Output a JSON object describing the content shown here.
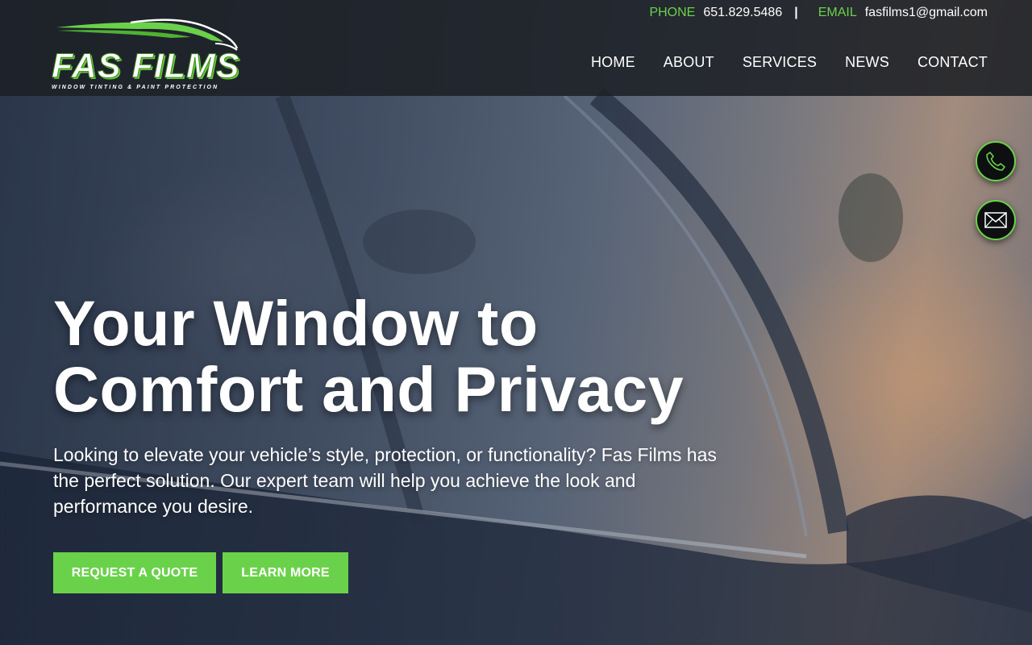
{
  "brand": {
    "name": "FAS FILMS",
    "tagline": "WINDOW TINTING & PAINT PROTECTION",
    "accent_color": "#6ad24a"
  },
  "topbar": {
    "phone_label": "PHONE",
    "phone_value": "651.829.5486",
    "separator": "|",
    "email_label": "EMAIL",
    "email_value": "fasfilms1@gmail.com"
  },
  "nav": {
    "items": [
      {
        "label": "HOME"
      },
      {
        "label": "ABOUT"
      },
      {
        "label": "SERVICES"
      },
      {
        "label": "NEWS"
      },
      {
        "label": "CONTACT"
      }
    ]
  },
  "floating": {
    "phone_icon": "phone-icon",
    "email_icon": "envelope-icon"
  },
  "hero": {
    "title_line1": "Your Window to",
    "title_line2": "Comfort and Privacy",
    "text": "Looking to elevate your vehicle’s style, protection, or functionality? Fas Films has the perfect solution. Our expert team will help you achieve the look and performance you desire.",
    "primary_button": "REQUEST A QUOTE",
    "secondary_button": "LEARN MORE"
  }
}
